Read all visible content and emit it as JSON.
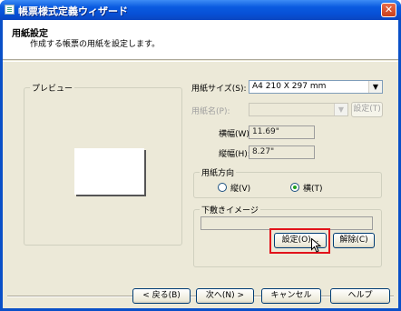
{
  "window": {
    "title": "帳票様式定義ウィザード",
    "close_glyph": "✕"
  },
  "header": {
    "title": "用紙設定",
    "subtitle": "作成する帳票の用紙を設定します。"
  },
  "preview": {
    "label": "プレビュー"
  },
  "paper_size": {
    "label": "用紙サイズ(S):",
    "value": "A4 210 X 297 mm"
  },
  "paper_name": {
    "label": "用紙名(P):",
    "value": "",
    "settings_button": "設定(T)"
  },
  "width": {
    "label": "横幅(W):",
    "value": "11.69\""
  },
  "height": {
    "label": "縦幅(H):",
    "value": "8.27\""
  },
  "orientation": {
    "label": "用紙方向",
    "options": [
      {
        "label": "縦(V)",
        "selected": false
      },
      {
        "label": "横(T)",
        "selected": true
      }
    ]
  },
  "underlay": {
    "label": "下敷きイメージ",
    "set_button": "設定(O)...",
    "clear_button": "解除(C)"
  },
  "footer": {
    "back_button": "< 戻る(B)",
    "next_button": "次へ(N) >",
    "cancel_button": "キャンセル",
    "help_button": "ヘルプ"
  },
  "icons": {
    "dropdown": "▼"
  },
  "colors": {
    "title_bar": "#0a5be0",
    "highlight": "#e2131b",
    "dialog_bg": "#ece9d8"
  }
}
